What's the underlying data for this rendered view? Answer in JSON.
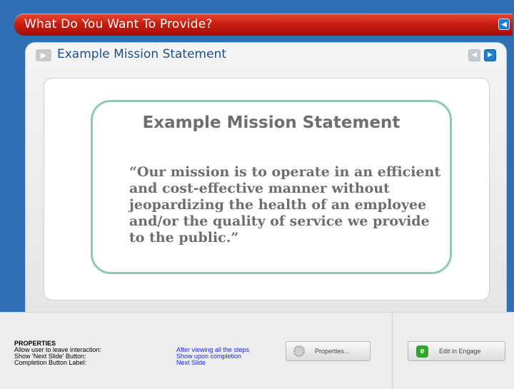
{
  "header": {
    "title": "What Do You Want To Provide?",
    "audio_icon": "speaker-icon"
  },
  "panel": {
    "step_icon": "step-indicator-icon",
    "title": "Example Mission Statement",
    "prev_icon": "previous-arrow-icon",
    "next_icon": "next-arrow-icon"
  },
  "slide": {
    "heading": "Example Mission Statement",
    "quote": "“Our mission is to operate in an efficient and cost-effective manner without jeopardizing the health of an employee and/or the quality of service we provide to the public.”"
  },
  "properties": {
    "heading": "PROPERTIES",
    "rows": [
      {
        "label": "Allow user to leave interaction:",
        "value": "After viewing all the steps"
      },
      {
        "label": "Show 'Next Slide' Button:",
        "value": "Show upon completion"
      },
      {
        "label": "Completion Button Label:",
        "value": "Next Slide"
      }
    ],
    "properties_button": "Properties...",
    "engage_button": "Edit in Engage"
  },
  "colors": {
    "title_bar": "#c81f12",
    "stage_background": "#2f6fb3",
    "panel_title": "#1f4f86",
    "slide_border": "#8fcab6",
    "property_value": "#1a2ad8"
  }
}
